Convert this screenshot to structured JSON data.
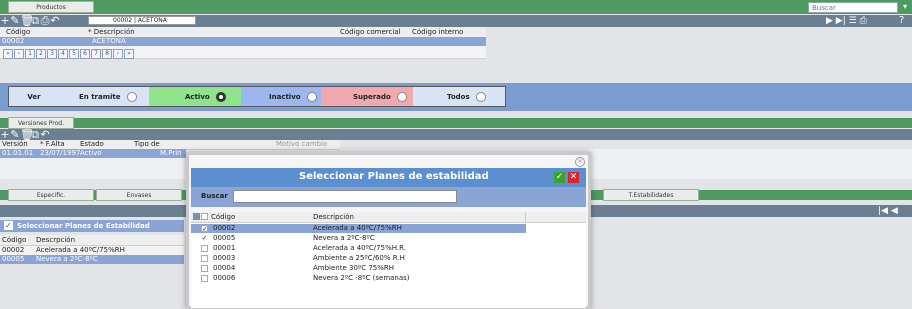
{
  "top": {
    "tab_label": "Productos",
    "search_placeholder": "Buscar",
    "help": "?"
  },
  "product": {
    "record_field": "00002 | ACETONA",
    "columns": [
      "Código",
      "* Descripción",
      "Código comercial",
      "Código interno"
    ],
    "row": {
      "codigo": "00002",
      "descripcion": "ACETONA"
    }
  },
  "pagination": [
    "«",
    "‹",
    "1",
    "2",
    "3",
    "4",
    "5",
    "6",
    "7",
    "8",
    "›",
    "»"
  ],
  "filter": {
    "ver": "Ver",
    "options": [
      {
        "label": "En tramite",
        "checked": false,
        "color": "#d8e4f5"
      },
      {
        "label": "Activo",
        "checked": true,
        "color": "#8ee38b"
      },
      {
        "label": "Inactivo",
        "checked": false,
        "color": "#9cb7f0"
      },
      {
        "label": "Superado",
        "checked": false,
        "color": "#f1a9b1"
      },
      {
        "label": "Todos",
        "checked": false,
        "color": "#d8e4f5"
      }
    ]
  },
  "versions": {
    "tab_label": "Versiones Prod.",
    "columns": [
      "Versión",
      "* F.Alta",
      "Estado",
      "Tipo de",
      "Motivo cambio"
    ],
    "row": {
      "version": "01.01.01",
      "fecha": "23/07/1997",
      "estado": "Activo",
      "tipo": "M.Prin"
    }
  },
  "lower_tabs": [
    "Especific.",
    "Envases",
    "T.Estabilidades"
  ],
  "left_panel": {
    "title": "Seleccionar Planes de Estabilidad",
    "columns": [
      "Código",
      "Descrpción"
    ],
    "rows": [
      {
        "codigo": "00002",
        "descripcion": "Acelerada a 40ºC/75%RH"
      },
      {
        "codigo": "00005",
        "descripcion": "Nevera a 2ºC-8ºC"
      }
    ]
  },
  "modal": {
    "title": "Seleccionar Planes de estabilidad",
    "search_label": "Buscar",
    "search_value": "",
    "columns": [
      "Código",
      "Descripción"
    ],
    "rows": [
      {
        "codigo": "00002",
        "descripcion": "Acelerada a 40ºC/75%RH",
        "checked": true
      },
      {
        "codigo": "00005",
        "descripcion": "Nevera a 2ºC-8ºC",
        "checked": true
      },
      {
        "codigo": "00001",
        "descripcion": "Acelerada a 40ºC/75%H.R.",
        "checked": false
      },
      {
        "codigo": "00003",
        "descripcion": "Ambiente a 25ºC/60% R.H",
        "checked": false
      },
      {
        "codigo": "00004",
        "descripcion": "Ambiente 30ºC 75%RH",
        "checked": false
      },
      {
        "codigo": "00006",
        "descripcion": "Nevera 2ºC -8ºC (semanas)",
        "checked": false
      }
    ]
  },
  "colors": {
    "accent_green": "#4f9a61",
    "toolbar": "#6b7f93",
    "selection": "#8aa4d6",
    "modal_title": "#5b8fcf"
  }
}
